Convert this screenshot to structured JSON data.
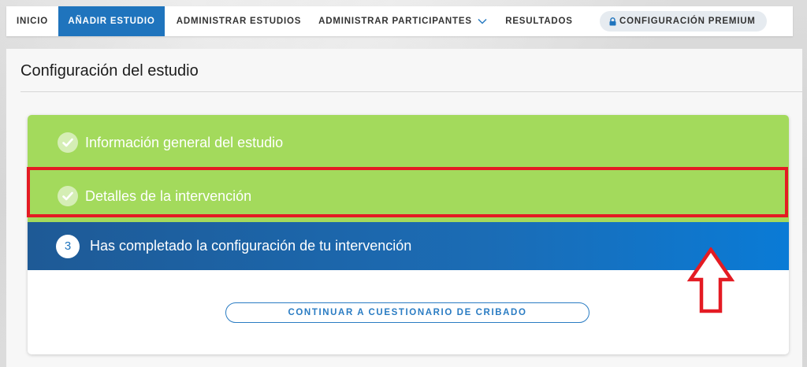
{
  "nav": {
    "items": [
      {
        "label": "INICIO",
        "active": false
      },
      {
        "label": "AÑADIR ESTUDIO",
        "active": true
      },
      {
        "label": "ADMINISTRAR ESTUDIOS",
        "active": false
      },
      {
        "label": "ADMINISTRAR PARTICIPANTES",
        "active": false,
        "icon": "chevron-down-icon"
      },
      {
        "label": "RESULTADOS",
        "active": false
      }
    ],
    "premium_label": "CONFIGURACIÓN PREMIUM",
    "premium_icon": "lock-icon"
  },
  "page": {
    "title": "Configuración del estudio"
  },
  "steps": [
    {
      "label": "Información general del estudio",
      "status": "completed",
      "icon": "check-icon"
    },
    {
      "label": "Detalles de la intervención",
      "status": "completed",
      "icon": "check-icon"
    },
    {
      "number": "3",
      "label": "Has completado la configuración de tu intervención",
      "status": "current"
    }
  ],
  "actions": {
    "continue_label": "CONTINUAR A CUESTIONARIO DE CRIBADO"
  },
  "colors": {
    "accent": "#1f74bd",
    "completed": "#a3da5c",
    "current_gradient_start": "#1e5a96",
    "current_gradient_end": "#0a7bd6",
    "annotation": "#e41b23"
  }
}
